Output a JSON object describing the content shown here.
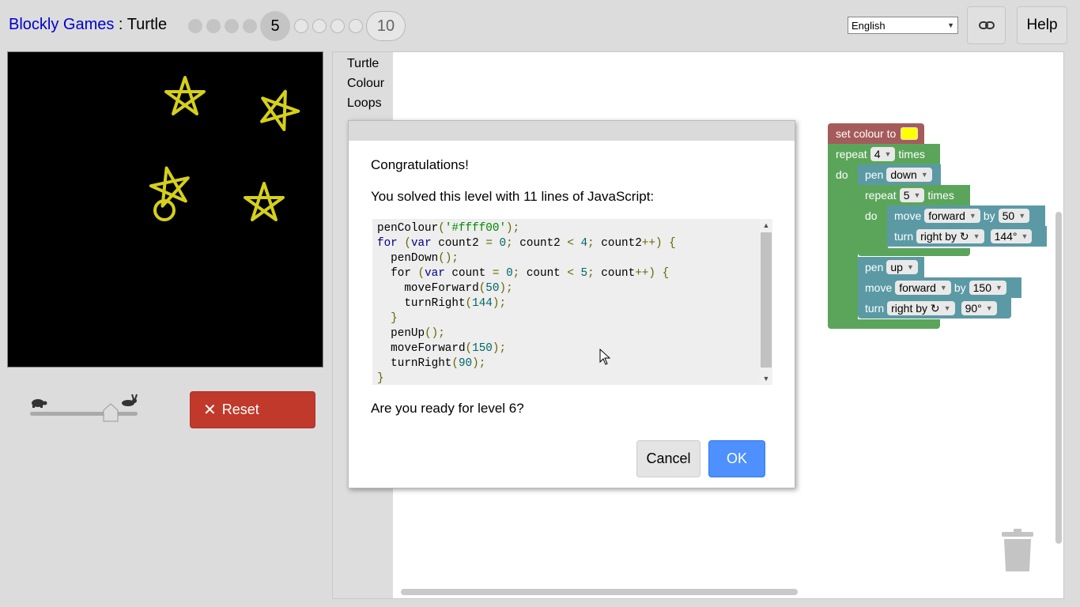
{
  "header": {
    "app_name": "Blockly Games",
    "separator": " : ",
    "game_name": "Turtle",
    "current_level": "5",
    "last_level": "10",
    "language": "English",
    "help_label": "Help"
  },
  "controls": {
    "reset_label": "Reset",
    "speed_value": 0.75
  },
  "toolbox": {
    "categories": [
      "Turtle",
      "Colour",
      "Loops"
    ]
  },
  "blocks": {
    "set_colour": "set colour to",
    "colour_value": "#ffff00",
    "repeat_label": "repeat",
    "times_label": "times",
    "do_label": "do",
    "outer_count": "4",
    "inner_count": "5",
    "pen_label": "pen",
    "pen_down": "down",
    "pen_up": "up",
    "move_label": "move",
    "direction_forward": "forward",
    "by_label": "by",
    "move_50": "50",
    "move_150": "150",
    "turn_label": "turn",
    "turn_dir": "right by ↻",
    "angle_144": "144°",
    "angle_90": "90°"
  },
  "dialog": {
    "congrats": "Congratulations!",
    "solved": "You solved this level with 11 lines of JavaScript:",
    "ready": "Are you ready for level 6?",
    "cancel_label": "Cancel",
    "ok_label": "OK",
    "code_lines": [
      "penColour('#ffff00');",
      "for (var count2 = 0; count2 < 4; count2++) {",
      "  penDown();",
      "  for (var count = 0; count < 5; count++) {",
      "    moveForward(50);",
      "    turnRight(144);",
      "  }",
      "  penUp();",
      "  moveForward(150);",
      "  turnRight(90);",
      "}"
    ]
  },
  "colors": {
    "pen": "#ffff00",
    "reset": "#c0392b",
    "ok": "#4d90fe",
    "colour_block": "#a55b5b",
    "loop_block": "#5ba55b",
    "turtle_block": "#5b9aa5"
  }
}
